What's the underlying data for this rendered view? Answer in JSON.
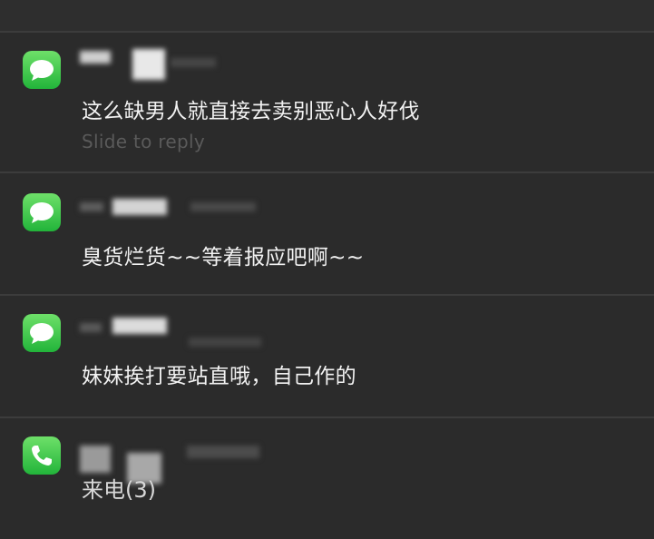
{
  "notifications": [
    {
      "app_icon": "messages-icon",
      "sender": "",
      "message": "这么缺男人就直接去卖别恶心人好伐",
      "hint": "Slide to reply"
    },
    {
      "app_icon": "messages-icon",
      "sender": "",
      "message": "臭货烂货~~等着报应吧啊~~"
    },
    {
      "app_icon": "messages-icon",
      "sender": "",
      "message": "妹妹挨打要站直哦，自己作的"
    },
    {
      "app_icon": "phone-icon",
      "sender": "",
      "message": "来电(3)"
    }
  ],
  "colors": {
    "background": "#2b2b2b",
    "divider": "#3c3c3c",
    "icon_green": "#2fc043",
    "text": "#f2f2f2",
    "hint": "#5a5a5a"
  }
}
